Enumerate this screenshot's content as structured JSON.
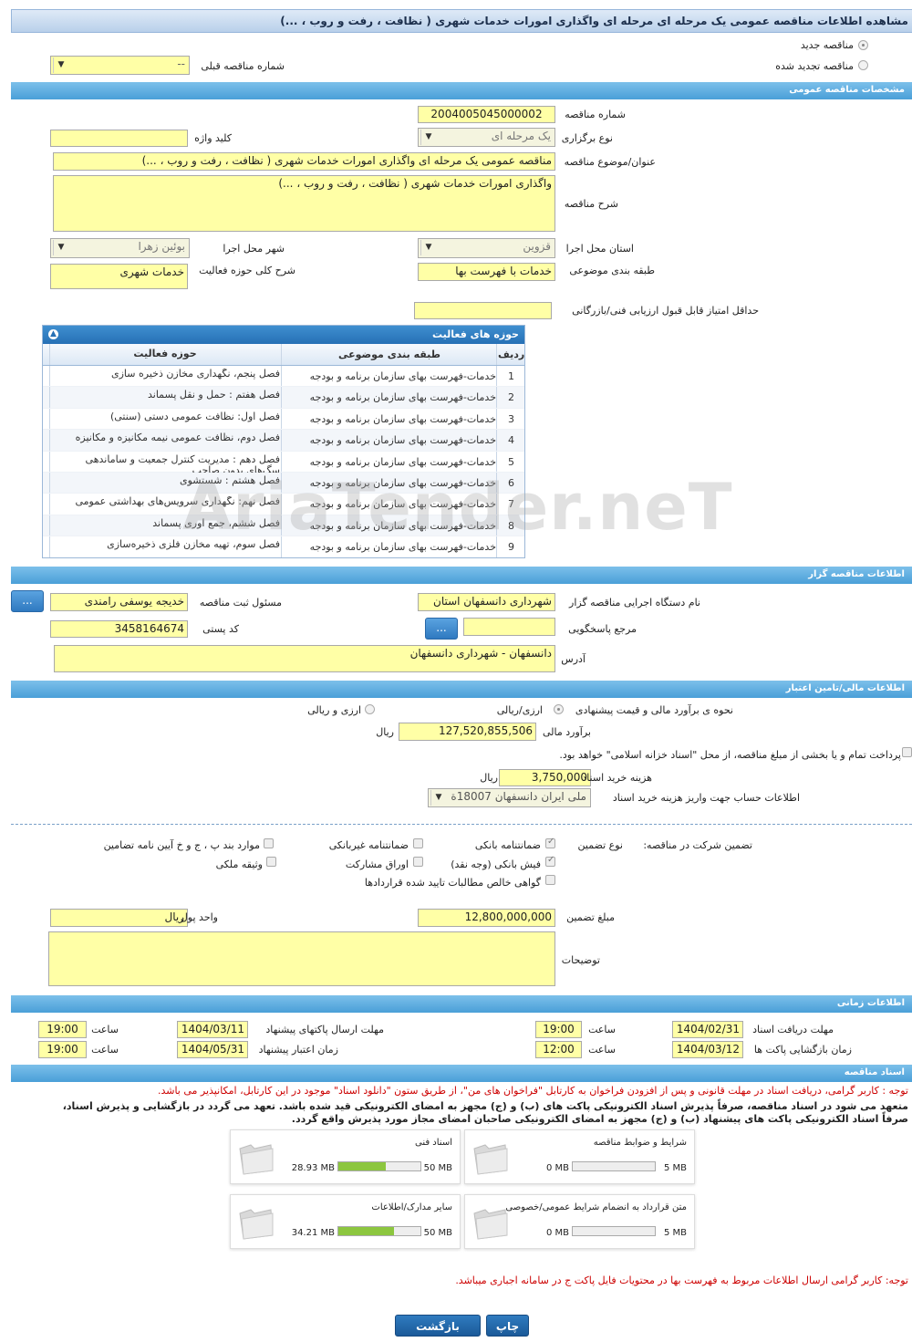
{
  "page_title": "مشاهده اطلاعات مناقصه عمومی یک مرحله ای مرحله ای واگذاری امورات خدمات شهری ( نظافت ، رفت و روب ، ...)",
  "tender_type": {
    "new_label": "مناقصه جدید",
    "renewed_label": "مناقصه تجدید شده",
    "prev_number_label": "شماره مناقصه قبلی",
    "prev_number_value": "--"
  },
  "general": {
    "section_title": "مشخصات مناقصه عمومی",
    "number_label": "شماره مناقصه",
    "number": "2004005045000002",
    "holding_type_label": "نوع برگزاری",
    "holding_type": "یک مرحله ای",
    "keyword_label": "کلید واژه",
    "keyword": "",
    "subject_label": "عنوان/موضوع مناقصه",
    "subject": "مناقصه عمومی یک مرحله ای واگذاری امورات خدمات شهری ( نظافت ، رفت و روب ، ...)",
    "description_label": "شرح مناقصه",
    "description": "واگذاری امورات خدمات شهری ( نظافت ، رفت و روب ، ...)",
    "province_label": "استان محل اجرا",
    "province": "قزوین",
    "city_label": "شهر محل اجرا",
    "city": "بوئین زهرا",
    "category_label": "طبقه بندی موضوعی",
    "category": "خدمات با فهرست بها",
    "activity_desc_label": "شرح کلی حوزه فعالیت",
    "activity_desc": "خدمات شهری",
    "min_score_label": "حداقل امتیاز قابل قبول ارزیابی فنی/بازرگانی",
    "min_score": ""
  },
  "activity_table": {
    "title": "حوزه های فعالیت",
    "col_row": "ردیف",
    "col_category": "طبقه بندی موضوعی",
    "col_activity": "حوزه فعالیت",
    "rows": [
      {
        "n": "1",
        "cat": "خدمات-فهرست بهای سازمان برنامه و بودجه",
        "act": "فصل پنجم، نگهداری مخازن ذخیره سازی"
      },
      {
        "n": "2",
        "cat": "خدمات-فهرست بهای سازمان برنامه و بودجه",
        "act": "فصل هفتم : حمل و نقل پسماند"
      },
      {
        "n": "3",
        "cat": "خدمات-فهرست بهای سازمان برنامه و بودجه",
        "act": "فصل اول: نظافت عمومی دستی (سنتی)"
      },
      {
        "n": "4",
        "cat": "خدمات-فهرست بهای سازمان برنامه و بودجه",
        "act": "فصل دوم، نظافت عمومی نیمه مکانیزه و مکانیزه"
      },
      {
        "n": "5",
        "cat": "خدمات-فهرست بهای سازمان برنامه و بودجه",
        "act": "فصل دهم : مدیریت کنترل جمعیت و ساماندهی سگ‌های بدون صاحب"
      },
      {
        "n": "6",
        "cat": "خدمات-فهرست بهای سازمان برنامه و بودجه",
        "act": "فصل هشتم : شستشوی"
      },
      {
        "n": "7",
        "cat": "خدمات-فهرست بهای سازمان برنامه و بودجه",
        "act": "فصل نهم: نگهداری سرویس‌های بهداشتی عمومی"
      },
      {
        "n": "8",
        "cat": "خدمات-فهرست بهای سازمان برنامه و بودجه",
        "act": "فصل ششم، جمع آوری پسماند"
      },
      {
        "n": "9",
        "cat": "خدمات-فهرست بهای سازمان برنامه و بودجه",
        "act": "فصل سوم، تهیه مخازن فلزی ذخیره‌سازی"
      }
    ]
  },
  "organizer": {
    "section_title": "اطلاعات مناقصه گزار",
    "org_label": "نام دستگاه اجرایی مناقصه گزار",
    "org": "شهرداری دانسفهان استان",
    "registrar_label": "مسئول ثبت مناقصه",
    "registrar": "خدیجه یوسفی رامندی",
    "ref_label": "مرجع پاسخگویی",
    "ref": "",
    "postal_label": "کد پستی",
    "postal": "3458164674",
    "address_label": "آدرس",
    "address": "دانسفهان - شهرداری دانسفهان",
    "more_label": "..."
  },
  "finance": {
    "section_title": "اطلاعات مالی/تامین اعتبار",
    "estimate_method_label": "نحوه ی برآورد مالی و قیمت پیشنهادی",
    "opt_rial": "ارزی/ریالی",
    "opt_both": "ارزی و ریالی",
    "estimate_label": "برآورد مالی",
    "estimate": "127,520,855,506",
    "currency": "ریال",
    "treasury_note": "پرداخت تمام و یا بخشی از مبلغ مناقصه، از محل \"اسناد خزانه اسلامی\" خواهد بود.",
    "doc_fee_label": "هزینه خرید اسناد",
    "doc_fee": "3,750,000",
    "account_label": "اطلاعات حساب جهت واریز هزینه خرید اسناد",
    "account": "ملی ایران دانسفهان 18007ة"
  },
  "guarantee": {
    "participation_label": "تضمین شرکت در مناقصه:",
    "type_label": "نوع تضمین",
    "bank_guarantee": "ضمانتنامه بانکی",
    "non_bank_guarantee": "ضمانتنامه غیربانکی",
    "clauses": "موارد بند پ ، ج و خ آیین نامه تضامین",
    "cash": "فیش بانکی (وجه نقد)",
    "bonds": "اوراق مشارکت",
    "property": "وثیقه ملکی",
    "receivables": "گواهی خالص مطالبات تایید شده قراردادها",
    "amount_label": "مبلغ تضمین",
    "amount": "12,800,000,000",
    "unit_label": "واحد پول",
    "unit": "ریال",
    "notes_label": "توضیحات",
    "notes": ""
  },
  "timing": {
    "section_title": "اطلاعات زمانی",
    "doc_deadline_label": "مهلت دریافت اسناد",
    "doc_deadline": "1404/02/31",
    "doc_time": "19:00",
    "submit_deadline_label": "مهلت ارسال پاکتهای پیشنهاد",
    "submit_deadline": "1404/03/11",
    "submit_time": "19:00",
    "opening_label": "زمان بازگشایی پاکت ها",
    "opening": "1404/03/12",
    "opening_time": "12:00",
    "validity_label": "زمان اعتبار پیشنهاد",
    "validity": "1404/05/31",
    "validity_time": "19:00",
    "time_label": "ساعت"
  },
  "documents": {
    "section_title": "اسناد مناقصه",
    "note1": "توجه : کاربر گرامی، دریافت اسناد در مهلت قانونی و پس از افزودن فراخوان به کارتابل \"فراخوان های من\"، از طریق ستون \"دانلود اسناد\" موجود در این کارتابل، امکانپذیر می باشد.",
    "note2a": "متعهد می شود در اسناد مناقصه، صرفاً پذیرش اسناد الکترونیکی پاکت های (ب) و (ج) مجهز به امضای الکترونیکی قید شده باشد. تعهد می گردد در بازگشایی و پذیرش اسناد،",
    "note2b": "صرفاً اسناد الکترونیکی پاکت های پیشنهاد (ب) و (ج) مجهز به امضای الکترونیکی صاحبان امضای مجاز مورد پذیرش واقع گردد.",
    "cards": [
      {
        "title": "شرایط و ضوابط مناقصه",
        "current": "0 MB",
        "max": "5 MB",
        "fill": 0
      },
      {
        "title": "اسناد فنی",
        "current": "28.93 MB",
        "max": "50 MB",
        "fill": 0.58
      },
      {
        "title": "متن قرارداد به انضمام شرایط عمومی/خصوصی",
        "current": "0 MB",
        "max": "5 MB",
        "fill": 0
      },
      {
        "title": "سایر مدارک/اطلاعات",
        "current": "34.21 MB",
        "max": "50 MB",
        "fill": 0.68
      }
    ],
    "note3": "توجه: کاربر گرامی ارسال اطلاعات مربوط به فهرست بها در محتویات فایل پاکت ج در سامانه اجباری میباشد."
  },
  "buttons": {
    "print": "چاپ",
    "back": "بازگشت"
  },
  "watermark": "AriaTender.neT"
}
